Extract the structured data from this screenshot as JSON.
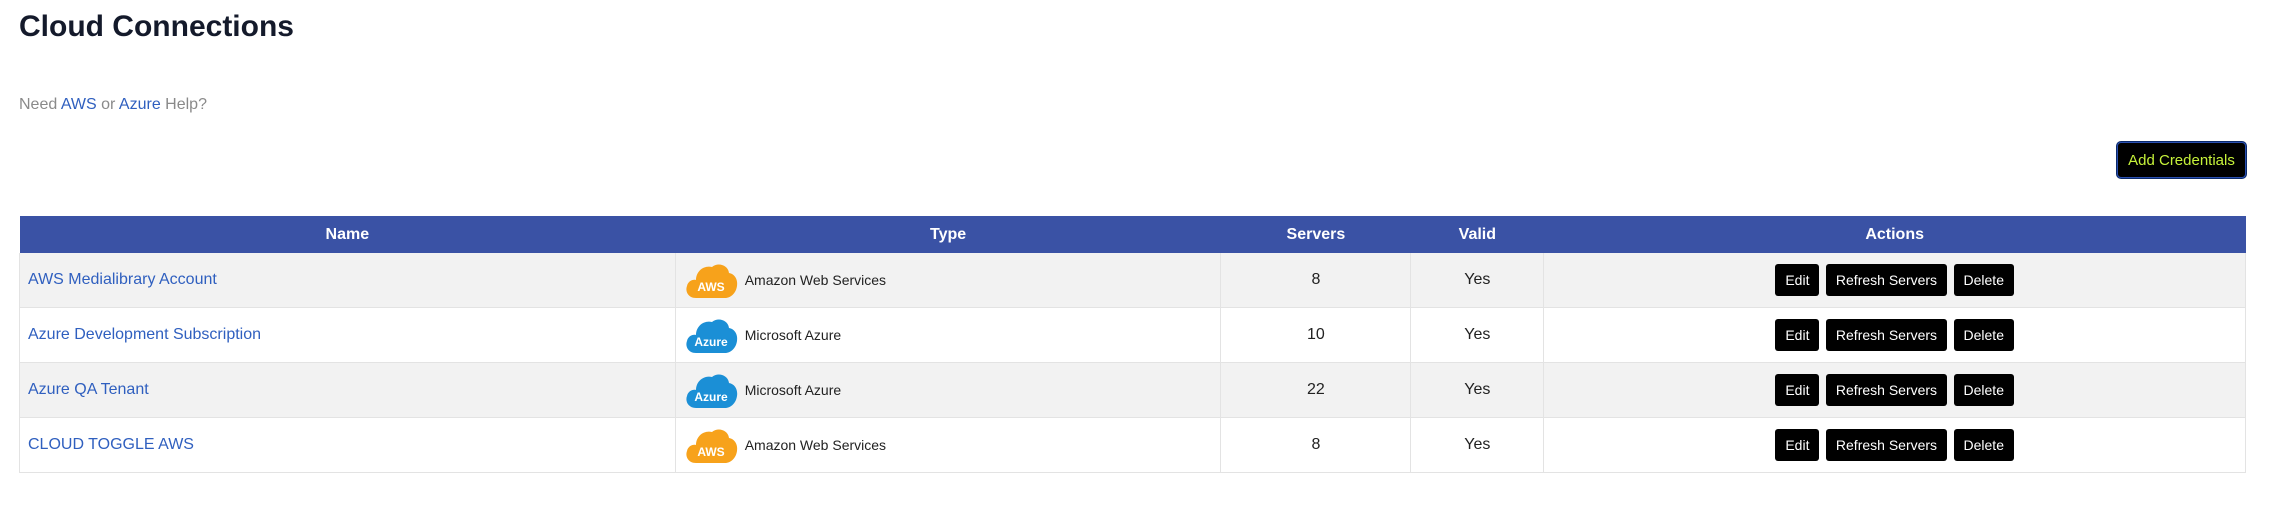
{
  "page": {
    "title": "Cloud Connections",
    "help_prefix": "Need",
    "help_aws": "AWS",
    "help_or": "or",
    "help_azure": "Azure",
    "help_suffix": "Help?",
    "add_button": "Add Credentials"
  },
  "table": {
    "headers": {
      "name": "Name",
      "type": "Type",
      "servers": "Servers",
      "valid": "Valid",
      "actions": "Actions"
    },
    "rows": [
      {
        "name": "AWS Medialibrary Account",
        "type": "Amazon Web Services",
        "icon": "aws-cloud-icon",
        "badge": "AWS",
        "servers": "8",
        "valid": "Yes"
      },
      {
        "name": "Azure Development Subscription",
        "type": "Microsoft Azure",
        "icon": "azure-cloud-icon",
        "badge": "Azure",
        "servers": "10",
        "valid": "Yes"
      },
      {
        "name": "Azure QA Tenant",
        "type": "Microsoft Azure",
        "icon": "azure-cloud-icon",
        "badge": "Azure",
        "servers": "22",
        "valid": "Yes"
      },
      {
        "name": "CLOUD TOGGLE AWS",
        "type": "Amazon Web Services",
        "icon": "aws-cloud-icon",
        "badge": "AWS",
        "servers": "8",
        "valid": "Yes"
      }
    ],
    "actions": {
      "edit": "Edit",
      "refresh": "Refresh Servers",
      "delete": "Delete"
    }
  },
  "colors": {
    "header_bg": "#3a52a5",
    "link": "#2f5fbf",
    "aws_orange": "#f7a21b",
    "azure_blue": "#1b8fd6",
    "add_button_text": "#c6f23a"
  }
}
